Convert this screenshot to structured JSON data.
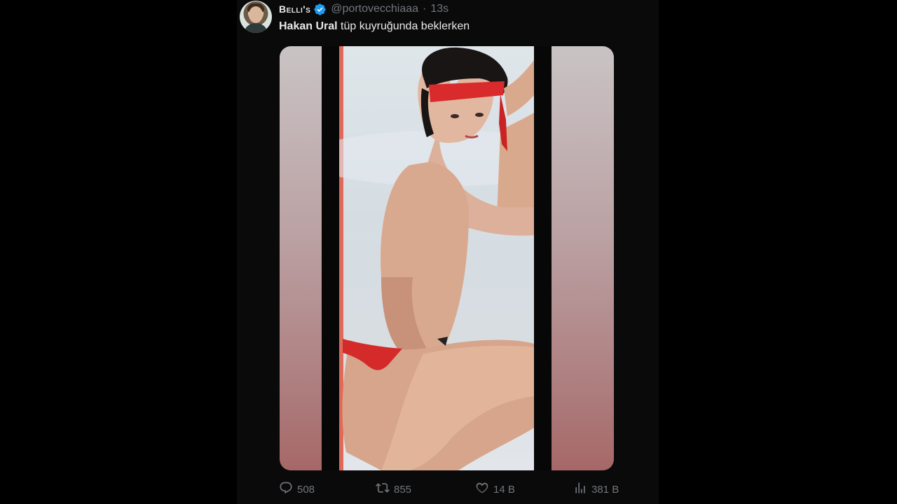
{
  "tweet": {
    "display_name": "Belli's",
    "handle": "@portovecchiaaa",
    "separator": "·",
    "time": "13s",
    "text_bold": "Hakan Ural",
    "text_rest": " tüp kuyruğunda beklerken",
    "avatar_icon": "profile-avatar",
    "verified_icon": "verified-badge-icon",
    "colors": {
      "background": "#000000",
      "text": "#e7e9ea",
      "muted": "#71767b",
      "verified": "#1d9bf0"
    }
  },
  "actions": {
    "reply_count": "508",
    "retweet_count": "855",
    "like_count": "14 B",
    "views_count": "381 B",
    "reply_icon": "reply-icon",
    "retweet_icon": "retweet-icon",
    "like_icon": "heart-icon",
    "views_icon": "views-icon"
  }
}
